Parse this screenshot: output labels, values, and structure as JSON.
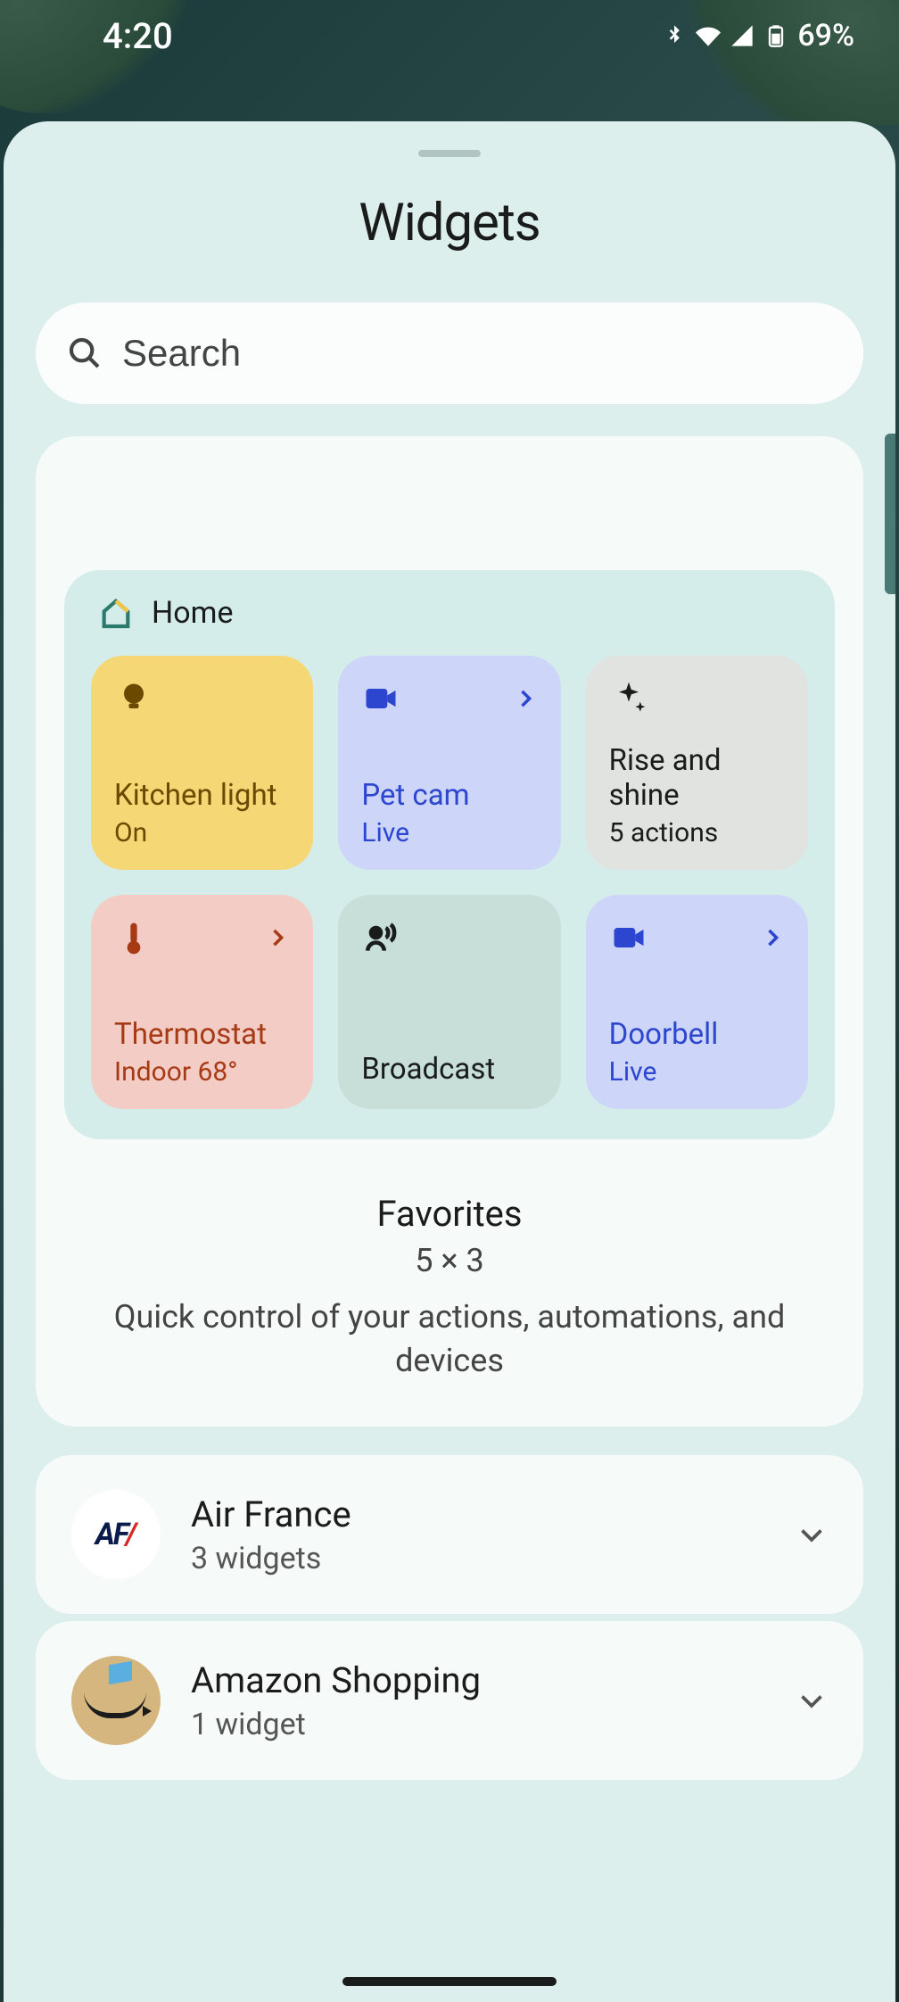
{
  "status": {
    "time": "4:20",
    "battery": "69%"
  },
  "panel_title": "Widgets",
  "search": {
    "placeholder": "Search"
  },
  "featured": {
    "header_label": "Home",
    "tiles": [
      {
        "title": "Kitchen light",
        "sub": "On"
      },
      {
        "title": "Pet cam",
        "sub": "Live"
      },
      {
        "title": "Rise and shine",
        "sub": "5 actions"
      },
      {
        "title": "Thermostat",
        "sub": "Indoor 68°"
      },
      {
        "title": "Broadcast",
        "sub": ""
      },
      {
        "title": "Doorbell",
        "sub": "Live"
      }
    ],
    "name": "Favorites",
    "size": "5 × 3",
    "desc": "Quick control of your actions, automations, and devices"
  },
  "apps": [
    {
      "name": "Air France",
      "count": "3 widgets"
    },
    {
      "name": "Amazon Shopping",
      "count": "1 widget"
    }
  ]
}
